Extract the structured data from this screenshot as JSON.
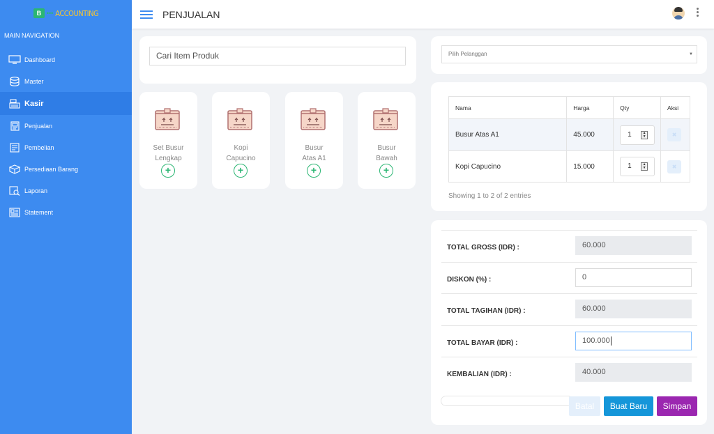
{
  "app": {
    "logo_text": "ACCOUNTING",
    "logo_mark": "B",
    "logo_sub": "•••"
  },
  "sidebar": {
    "header": "MAIN NAVIGATION",
    "items": [
      {
        "label": "Dashboard",
        "icon": "monitor-icon"
      },
      {
        "label": "Master",
        "icon": "database-icon"
      },
      {
        "label": "Kasir",
        "icon": "cash-register-icon",
        "active": true
      },
      {
        "label": "Penjualan",
        "icon": "sales-icon"
      },
      {
        "label": "Pembelian",
        "icon": "purchase-icon"
      },
      {
        "label": "Persediaan Barang",
        "icon": "inventory-icon"
      },
      {
        "label": "Laporan",
        "icon": "report-icon"
      },
      {
        "label": "Statement",
        "icon": "statement-icon"
      }
    ]
  },
  "header": {
    "title": "PENJUALAN"
  },
  "search": {
    "placeholder": "Cari Item Produk"
  },
  "products": [
    {
      "name_line1": "Set Busur",
      "name_line2": "Lengkap"
    },
    {
      "name_line1": "Kopi",
      "name_line2": "Capucino"
    },
    {
      "name_line1": "Busur",
      "name_line2": "Atas A1"
    },
    {
      "name_line1": "Busur",
      "name_line2": "Bawah"
    }
  ],
  "customer_select": {
    "placeholder": "Pilih Pelanggan"
  },
  "cart": {
    "columns": [
      "Nama",
      "Harga",
      "Qty",
      "Aksi"
    ],
    "rows": [
      {
        "nama": "Busur Atas A1",
        "harga": "45.000",
        "qty": "1"
      },
      {
        "nama": "Kopi Capucino",
        "harga": "15.000",
        "qty": "1"
      }
    ],
    "entries_info": "Showing 1 to 2 of 2 entries"
  },
  "summary": {
    "total_gross_label": "TOTAL GROSS (IDR) :",
    "total_gross": "60.000",
    "diskon_label": "DISKON (%) :",
    "diskon": "0",
    "total_tagihan_label": "TOTAL TAGIHAN (IDR) :",
    "total_tagihan": "60.000",
    "total_bayar_label": "TOTAL BAYAR (IDR) :",
    "total_bayar": "100.000",
    "kembalian_label": "KEMBALIAN (IDR) :",
    "kembalian": "40.000"
  },
  "buttons": {
    "batal": "Batal",
    "buat_baru": "Buat Baru",
    "simpan": "Simpan"
  },
  "colors": {
    "sidebar": "#3d8bf0",
    "add": "#2bb673",
    "buat_baru": "#1596d9",
    "simpan": "#9b27b0",
    "batal": "#e4effb"
  }
}
